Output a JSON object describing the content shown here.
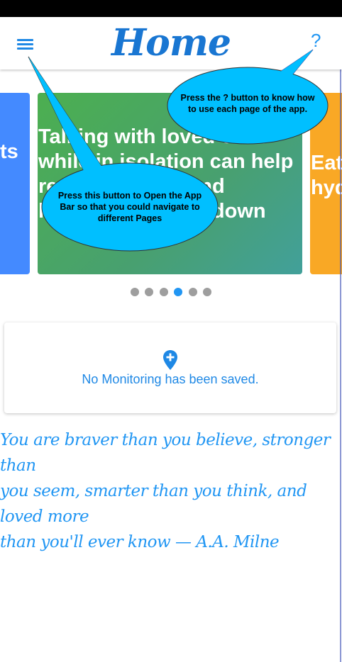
{
  "header": {
    "title": "Home",
    "help_label": "?",
    "menu_icon": "menu-icon"
  },
  "carousel": {
    "left_card_text": "ts",
    "center_card_text": "Talking with loved ones\nwhile in isolation can help\nreduce anxiety and\nhelp you calming down",
    "right_card_text": "Eat\nhyd",
    "page_count": 6,
    "active_index": 3
  },
  "monitoring": {
    "icon": "add-location-icon",
    "empty_message": "No Monitoring has been saved."
  },
  "quote": {
    "line1": "You are braver than you believe, stronger than",
    "line2": "you seem, smarter than you think, and loved more",
    "line3": "than you'll ever know — A.A. Milne"
  },
  "callouts": {
    "help_line1": "Press the  ? button to know how",
    "help_line2": "to use each page of the app.",
    "menu_line1": "Press this button to Open the App",
    "menu_line2": "Bar  so that you could  navigate to",
    "menu_line3": "different Pages"
  },
  "colors": {
    "accent": "#1e88e5",
    "callout_fill": "#00bfff",
    "card_green": "#4caf50",
    "card_blue": "#448aff",
    "card_orange": "#f9a825"
  }
}
